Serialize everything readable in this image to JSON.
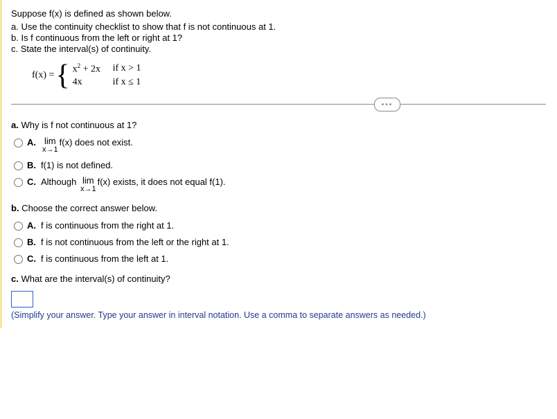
{
  "intro": "Suppose f(x) is defined as shown below.",
  "subparts": {
    "a": "a. Use the continuity checklist to show that f is not continuous at 1.",
    "b": "b. Is f continuous from the left or right at 1?",
    "c": "c. State the interval(s) of continuity."
  },
  "piecewise": {
    "lhs": "f(x) =",
    "row1_expr": "x",
    "row1_sup": "2",
    "row1_tail": " + 2x",
    "row1_cond": "if x > 1",
    "row2_expr": "4x",
    "row2_cond": "if x ≤ 1"
  },
  "ellipsis": "•••",
  "qa": {
    "prompt_bold": "a.",
    "prompt_rest": " Why is f not continuous at 1?",
    "options": [
      {
        "letter": "A.",
        "pre": "",
        "lim_top": "lim",
        "lim_bot": "x→1",
        "post": " f(x) does not exist."
      },
      {
        "letter": "B.",
        "plain": "f(1) is not defined."
      },
      {
        "letter": "C.",
        "pre": "Although ",
        "lim_top": "lim",
        "lim_bot": "x→1",
        "post": " f(x) exists, it does not equal f(1)."
      }
    ]
  },
  "qb": {
    "prompt_bold": "b.",
    "prompt_rest": " Choose the correct answer below.",
    "options": [
      {
        "letter": "A.",
        "text": "f is continuous from the right at 1."
      },
      {
        "letter": "B.",
        "text": "f is not continuous from the left or the right at 1."
      },
      {
        "letter": "C.",
        "text": "f is continuous from the left at 1."
      }
    ]
  },
  "qc": {
    "prompt_bold": "c.",
    "prompt_rest": " What are the interval(s) of continuity?",
    "hint": "(Simplify your answer. Type your answer in interval notation. Use a comma to separate answers as needed.)"
  }
}
